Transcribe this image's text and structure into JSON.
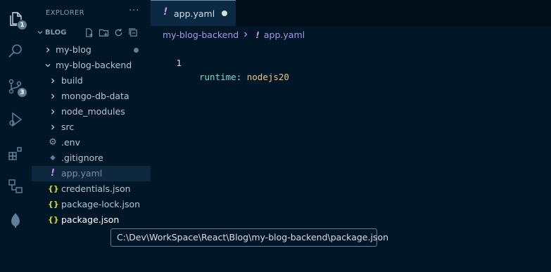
{
  "sidebar": {
    "title": "EXPLORER",
    "more": "···",
    "workspace": "BLOG",
    "items": [
      {
        "label": "my-blog",
        "type": "folder",
        "expanded": false,
        "modified": true
      },
      {
        "label": "my-blog-backend",
        "type": "folder",
        "expanded": true
      },
      {
        "label": "build",
        "type": "folder",
        "expanded": false
      },
      {
        "label": "mongo-db-data",
        "type": "folder",
        "expanded": false
      },
      {
        "label": "node_modules",
        "type": "folder",
        "expanded": false
      },
      {
        "label": "src",
        "type": "folder",
        "expanded": false
      },
      {
        "label": ".env",
        "type": "file",
        "icon": "gear-icon"
      },
      {
        "label": ".gitignore",
        "type": "file",
        "icon": "git-icon"
      },
      {
        "label": "app.yaml",
        "type": "file",
        "icon": "yaml-icon",
        "selected": true
      },
      {
        "label": "credentials.json",
        "type": "file",
        "icon": "json-icon"
      },
      {
        "label": "package-lock.json",
        "type": "file",
        "icon": "json-icon"
      },
      {
        "label": "package.json",
        "type": "file",
        "icon": "json-icon",
        "hovered": true
      }
    ]
  },
  "activity": {
    "explorer_badge": "1",
    "scm_badge": "3"
  },
  "icons": {
    "yaml_glyph": "!",
    "json_glyph": "{}",
    "gear_glyph": "⚙",
    "git_glyph": "◆"
  },
  "tab": {
    "label": "app.yaml",
    "dirty": true
  },
  "breadcrumb": {
    "folder": "my-blog-backend",
    "file": "app.yaml"
  },
  "editor": {
    "lines": [
      {
        "number": "1",
        "key": "runtime",
        "sep": ": ",
        "value": "nodejs20"
      }
    ]
  },
  "tooltip": {
    "text": "C:\\Dev\\WorkSpace\\React\\Blog\\my-blog-backend\\package.json"
  },
  "colors": {
    "background": "#011627",
    "selection": "#0e293f",
    "yaml": "#c792ea",
    "json": "#d7d72b",
    "key": "#7fdbca",
    "value": "#ecc48d"
  }
}
